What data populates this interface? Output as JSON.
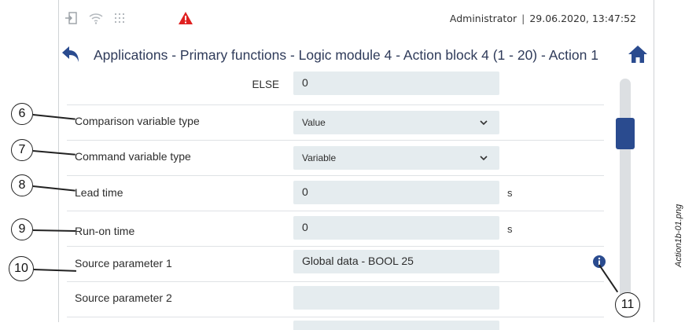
{
  "status_bar": {
    "user": "Administrator",
    "separator": "|",
    "datetime": "29.06.2020, 13:47:52",
    "icons": [
      "login-icon",
      "wifi-icon",
      "network-grid-icon",
      "warning-icon"
    ],
    "warning_color": "#e02020"
  },
  "header": {
    "breadcrumb": "Applications - Primary functions - Logic module 4 - Action block 4 (1 - 20) - Action 1",
    "accent_color": "#2a4b8f"
  },
  "rows": [
    {
      "label": "ELSE",
      "value": "0",
      "unit": "",
      "control": "input"
    },
    {
      "label": "Comparison variable type",
      "value": "Value",
      "unit": "",
      "control": "select"
    },
    {
      "label": "Command variable type",
      "value": "Variable",
      "unit": "",
      "control": "select"
    },
    {
      "label": "Lead time",
      "value": "0",
      "unit": "s",
      "control": "input"
    },
    {
      "label": "Run-on time",
      "value": "0",
      "unit": "s",
      "control": "input"
    },
    {
      "label": "Source parameter 1",
      "value": "Global data - BOOL 25",
      "unit": "",
      "control": "input"
    },
    {
      "label": "Source parameter 2",
      "value": "",
      "unit": "",
      "control": "input"
    }
  ],
  "callouts": [
    "6",
    "7",
    "8",
    "9",
    "10",
    "11"
  ],
  "side_caption": "Action1b-01.png"
}
